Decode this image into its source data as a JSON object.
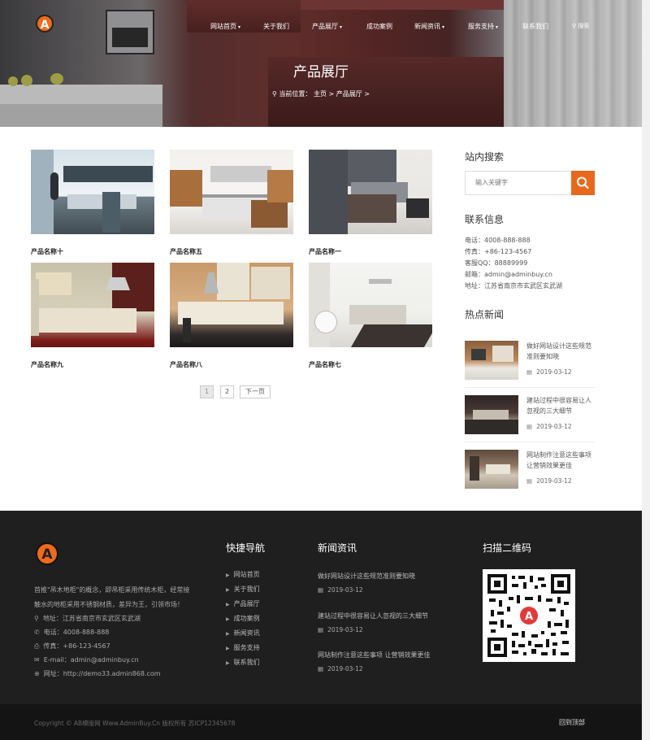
{
  "header": {
    "logo_letter": "A",
    "nav": [
      {
        "label": "网站首页",
        "caret": true
      },
      {
        "label": "关于我们",
        "caret": false
      },
      {
        "label": "产品展厅",
        "caret": true
      },
      {
        "label": "成功案例",
        "caret": false
      },
      {
        "label": "新闻资讯",
        "caret": true
      },
      {
        "label": "服务支持",
        "caret": true
      },
      {
        "label": "联系我们",
        "caret": false
      }
    ],
    "search_label": "搜索",
    "page_title": "产品展厅",
    "breadcrumb": "当前位置： 主页 > 产品展厅 >"
  },
  "products": [
    {
      "name": "产品名称十"
    },
    {
      "name": "产品名称五"
    },
    {
      "name": "产品名称一"
    },
    {
      "name": "产品名称九"
    },
    {
      "name": "产品名称八"
    },
    {
      "name": "产品名称七"
    }
  ],
  "pagination": {
    "pages": [
      "1",
      "2"
    ],
    "next": "下一页",
    "current": "1"
  },
  "sidebar": {
    "search_title": "站内搜索",
    "search_placeholder": "输入关键字",
    "contact_title": "联系信息",
    "contact": [
      "电话：4008-888-888",
      "传真：+86-123-4567",
      "客服QQ：88889999",
      "邮箱：admin@adminbuy.cn",
      "地址：江苏省南京市玄武区玄武湖"
    ],
    "hot_title": "热点新闻",
    "hot_news": [
      {
        "title": "做好网站设计这些规范准则要知晓",
        "date": "2019-03-12"
      },
      {
        "title": "建站过程中很容易让人忽视的三大细节",
        "date": "2019-03-12"
      },
      {
        "title": "网站制作注意这些事项 让营销效果更佳",
        "date": "2019-03-12"
      }
    ]
  },
  "footer": {
    "about": [
      "首推\"吊木地柜\"的概念，即吊柜采用传统木柜，经常接",
      "触水的地柜采用不锈钢材质，差异为王，引领市场！"
    ],
    "contact": [
      {
        "icon": "map-marker-icon",
        "glyph": "⚲",
        "text": "地址：江苏省南京市玄武区玄武湖"
      },
      {
        "icon": "phone-icon",
        "glyph": "✆",
        "text": "电话：4008-888-888"
      },
      {
        "icon": "fax-icon",
        "glyph": "⎙",
        "text": "传真：+86-123-4567"
      },
      {
        "icon": "envelope-icon",
        "glyph": "✉",
        "text": "E-mail：admin@adminbuy.cn"
      },
      {
        "icon": "globe-icon",
        "glyph": "⊕",
        "text": "网址：http://demo33.admin868.com"
      }
    ],
    "quick_nav_title": "快捷导航",
    "quick_nav": [
      "网站首页",
      "关于我们",
      "产品展厅",
      "成功案例",
      "新闻资讯",
      "服务支持",
      "联系我们"
    ],
    "news_title": "新闻资讯",
    "news": [
      {
        "title": "做好网站设计这些规范准则要知晓",
        "date": "2019-03-12"
      },
      {
        "title": "建站过程中很容易让人忽视的三大细节",
        "date": "2019-03-12"
      },
      {
        "title": "网站制作注意这些事项 让营销效果更佳",
        "date": "2019-03-12"
      }
    ],
    "qr_title": "扫描二维码",
    "copyright": "Copyright © AB模版网 Www.AdminBuy.Cn 版权所有   苏ICP12345678",
    "back_to_top": "回到顶部"
  },
  "colors": {
    "accent": "#e8691d",
    "footer_bg": "#1f1f1f",
    "footer_bottom_bg": "#141414"
  }
}
